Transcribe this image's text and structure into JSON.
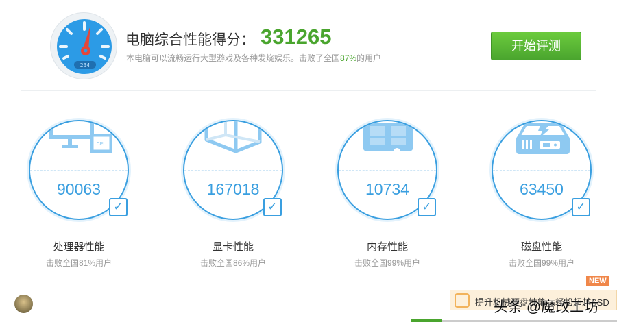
{
  "header": {
    "title": "电脑综合性能得分：",
    "score": "331265",
    "desc_prefix": "本电脑可以流畅运行大型游戏及各种发烧娱乐。击败了全国",
    "desc_pct": "87%",
    "desc_suffix": "的用户",
    "gauge_readout": "234",
    "start_button": "开始评测"
  },
  "cards": [
    {
      "score": "90063",
      "label": "处理器性能",
      "beat": "击败全国81%用户",
      "icon_text": "CPU"
    },
    {
      "score": "167018",
      "label": "显卡性能",
      "beat": "击败全国86%用户"
    },
    {
      "score": "10734",
      "label": "内存性能",
      "beat": "击败全国99%用户"
    },
    {
      "score": "63450",
      "label": "磁盘性能",
      "beat": "击败全国99%用户"
    }
  ],
  "promo": {
    "badge": "NEW",
    "text": "提升机械硬盘性能，轻松超越SSD"
  },
  "watermark": "头条 @魔改工坊",
  "colors": {
    "accent": "#3a9fe0",
    "green": "#4aa52e"
  }
}
